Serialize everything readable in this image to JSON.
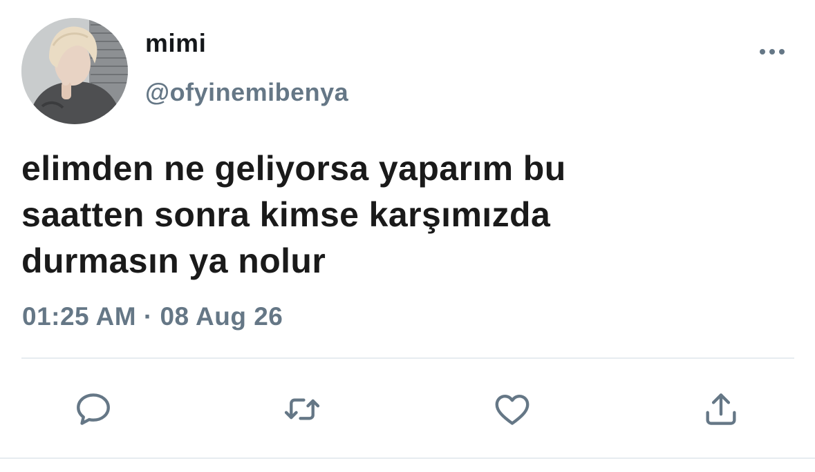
{
  "user": {
    "display_name": "mimi",
    "handle": "@ofyinemibenya",
    "avatar_icon": "profile-photo"
  },
  "tweet": {
    "text_lines": [
      "elimden ne geliyorsa yaparım bu",
      "saatten sonra kimse karşımızda",
      "durmasın ya nolur"
    ],
    "timestamp": "01:25 AM · 08 Aug 26"
  },
  "actions": [
    {
      "name": "reply",
      "icon": "reply-icon"
    },
    {
      "name": "retweet",
      "icon": "retweet-icon"
    },
    {
      "name": "like",
      "icon": "heart-icon"
    },
    {
      "name": "share",
      "icon": "share-icon"
    }
  ],
  "colors": {
    "text": "#14171a",
    "secondary": "#657786",
    "divider": "#e6ecf0"
  }
}
